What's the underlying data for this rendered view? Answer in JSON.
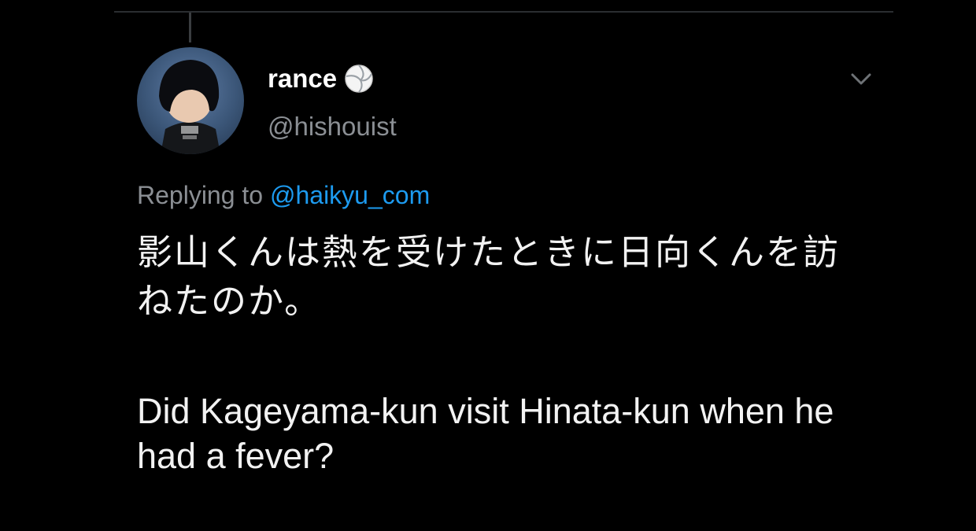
{
  "tweet": {
    "author": {
      "display_name": "rance",
      "handle": "@hishouist",
      "badge_icon": "volleyball-icon",
      "avatar_icon": "character-avatar"
    },
    "reply_prefix": "Replying to",
    "reply_to": "@haikyu_com",
    "text_jp": "影山くんは熱を受けたときに日向くんを訪ねたのか。",
    "text_en": "Did Kageyama-kun visit Hinata-kun when he had a fever?",
    "menu_icon": "chevron-down-icon"
  },
  "colors": {
    "background": "#000000",
    "primary_text": "#f2f2f2",
    "secondary_text": "#8b8f94",
    "link": "#1d9bf0"
  }
}
